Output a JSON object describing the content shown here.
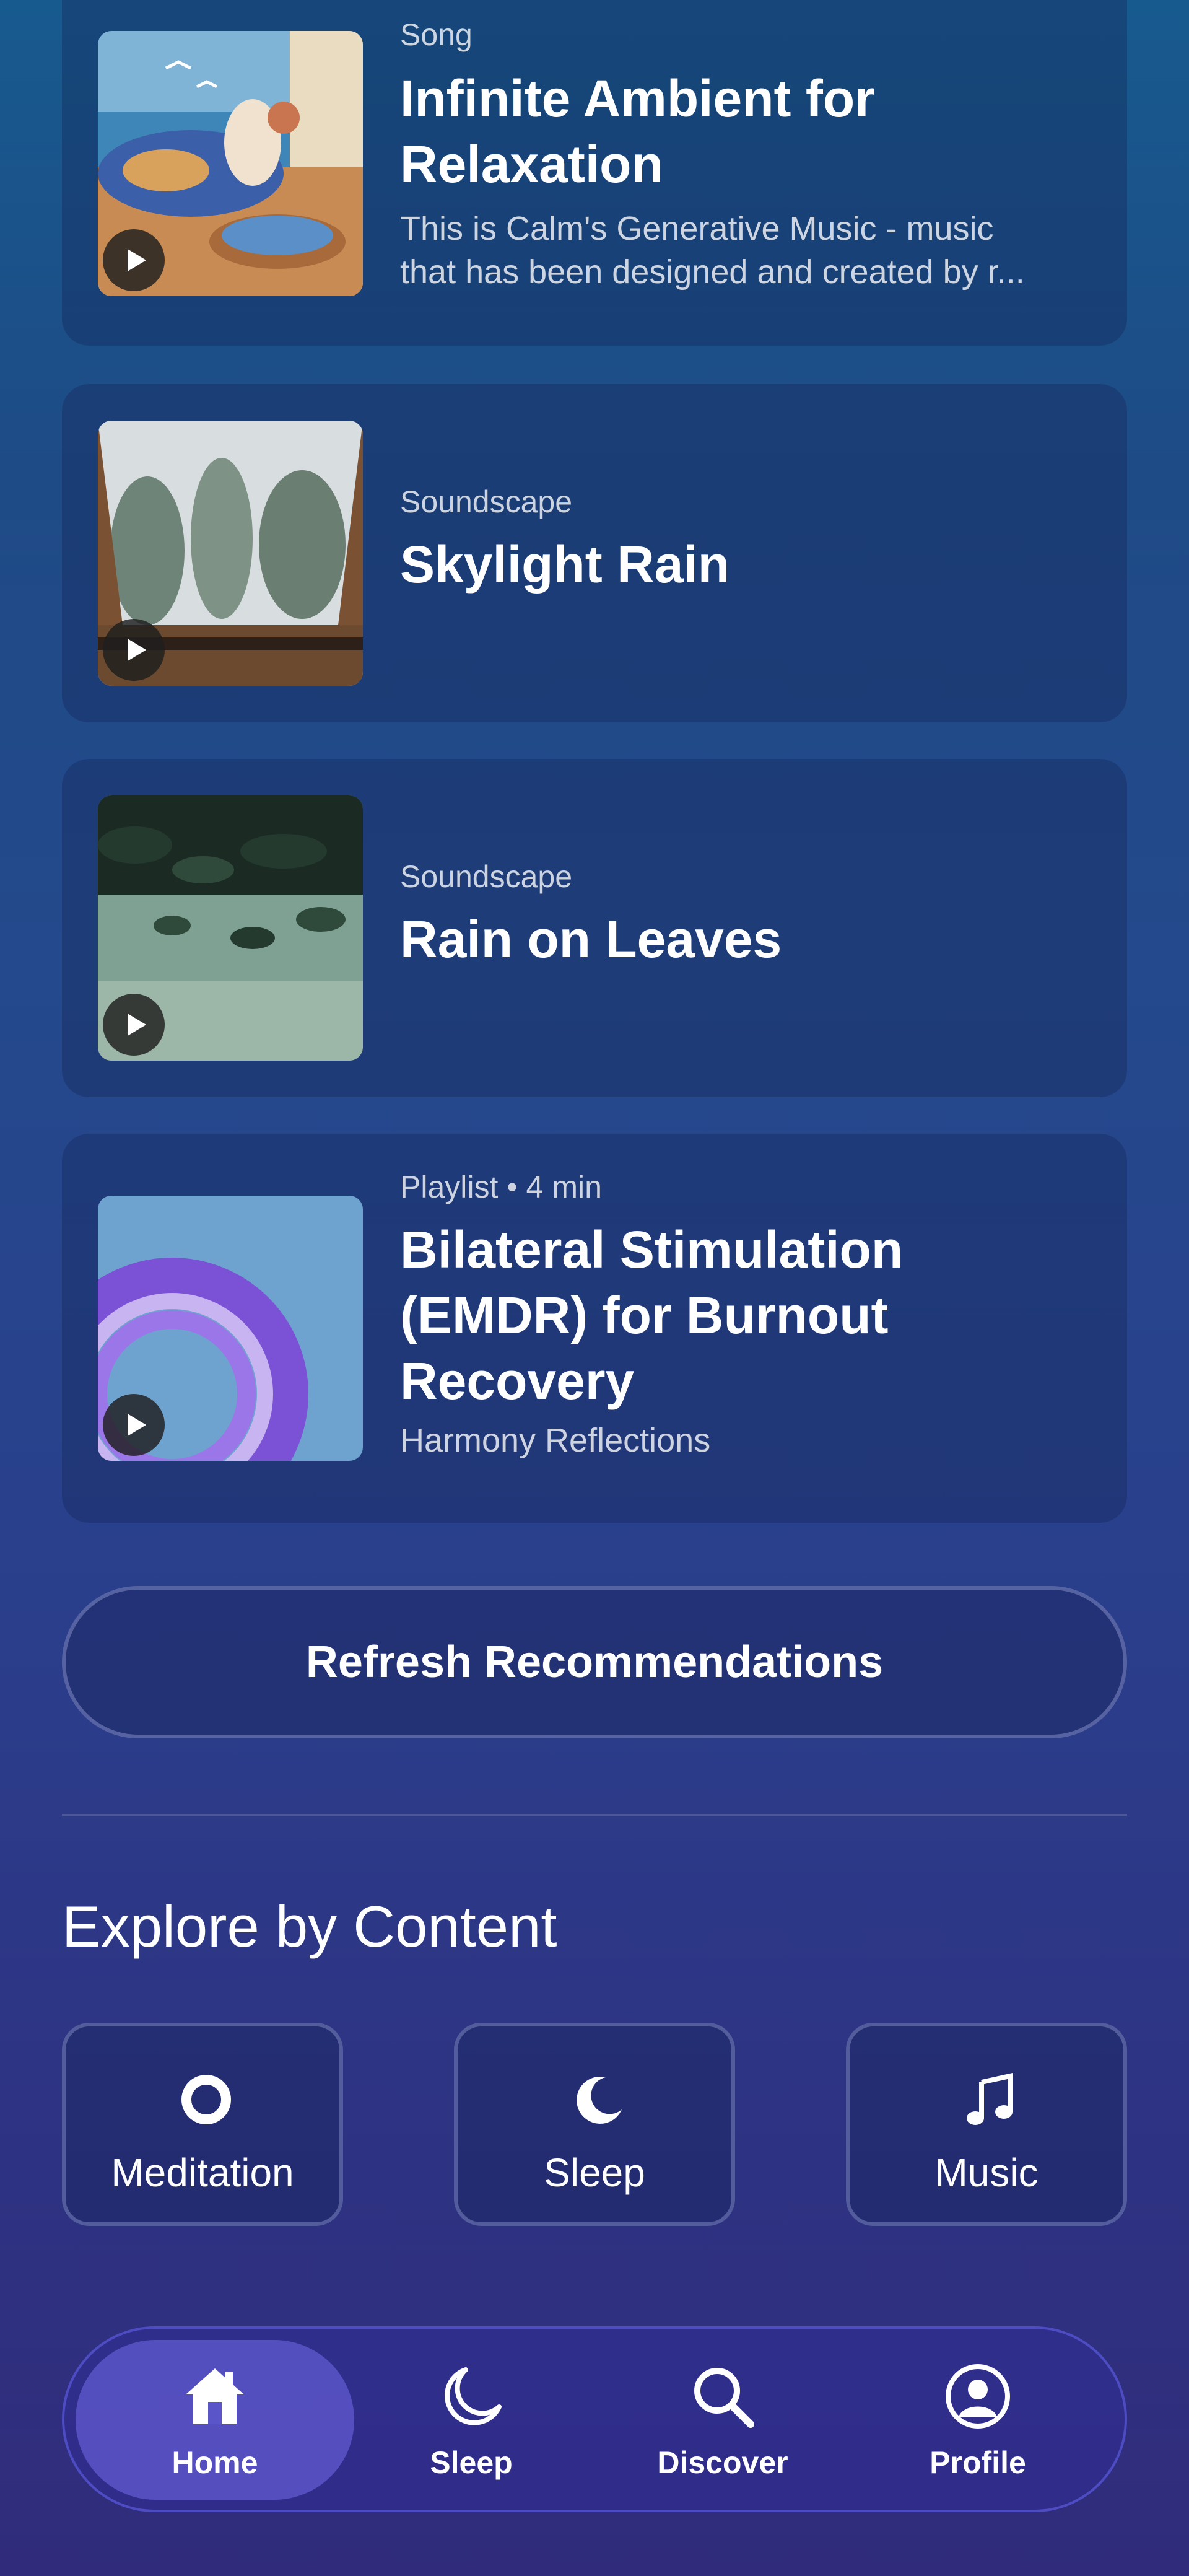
{
  "recommendations": [
    {
      "kind": "Song",
      "title_line1": "Infinite Ambient for",
      "title_line2": "Relaxation",
      "desc_line1": "This is Calm's Generative Music - music",
      "desc_line2": "that has been designed and created by r..."
    },
    {
      "kind": "Soundscape",
      "title": "Skylight Rain"
    },
    {
      "kind": "Soundscape",
      "title": "Rain on Leaves"
    },
    {
      "kind": "Playlist • 4 min",
      "title_line1": "Bilateral Stimulation",
      "title_line2": "(EMDR) for Burnout",
      "title_line3": "Recovery",
      "author": "Harmony Reflections"
    }
  ],
  "refresh_label": "Refresh Recommendations",
  "explore": {
    "title": "Explore by Content",
    "tiles": [
      {
        "label": "Meditation",
        "icon": "ring-icon"
      },
      {
        "label": "Sleep",
        "icon": "moon-icon"
      },
      {
        "label": "Music",
        "icon": "music-note-icon"
      }
    ]
  },
  "nav": {
    "items": [
      {
        "label": "Home",
        "icon": "home-icon",
        "active": true
      },
      {
        "label": "Sleep",
        "icon": "moon-icon",
        "active": false
      },
      {
        "label": "Discover",
        "icon": "search-icon",
        "active": false
      },
      {
        "label": "Profile",
        "icon": "profile-icon",
        "active": false
      }
    ]
  },
  "colors": {
    "background_top": "#175a8e",
    "background_bottom": "#302c7b",
    "nav_active": "#5a55c8"
  }
}
